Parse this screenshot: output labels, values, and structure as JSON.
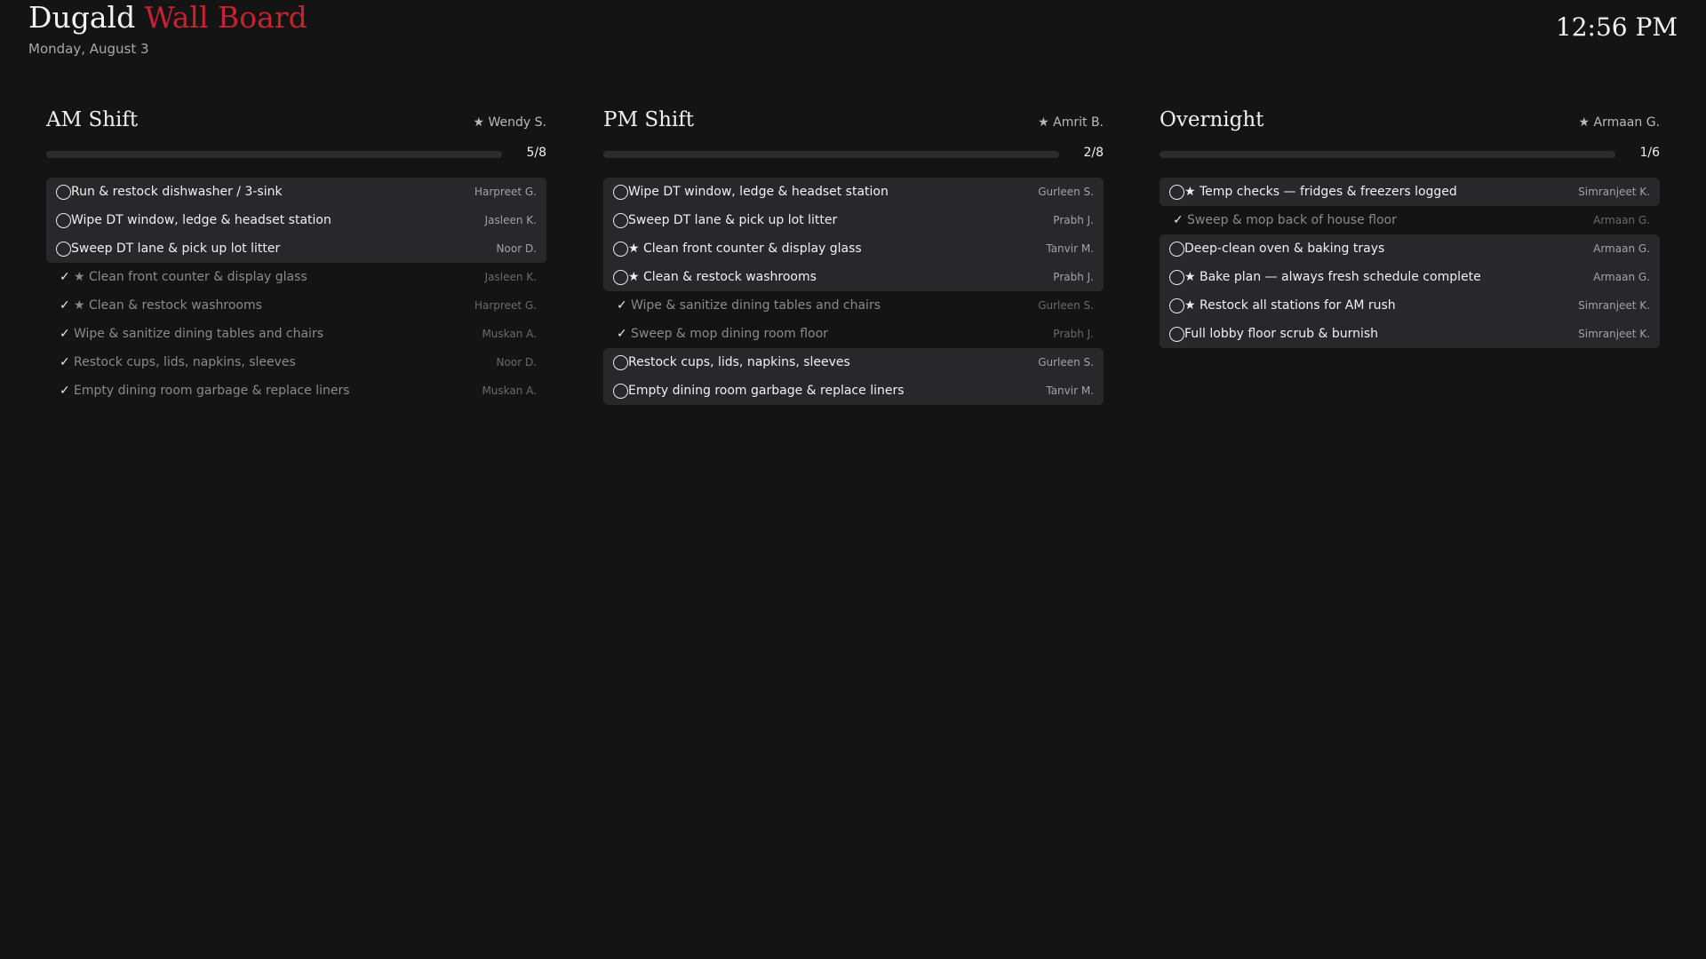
{
  "header": {
    "brand_name": "Dugald",
    "brand_suffix": "Wall Board",
    "date": "Monday, August 3",
    "time": "12:56 PM"
  },
  "colors": {
    "accent": "#c8212f",
    "background": "#141415",
    "row_open": "#28282a"
  },
  "columns": [
    {
      "title": "AM Shift",
      "lead": "★ Wendy S.",
      "progress": {
        "done": 5,
        "total": 8,
        "label": "5/8"
      },
      "tasks": [
        {
          "label": "Run & restock dishwasher / 3-sink",
          "who": "Harpreet G.",
          "done": false
        },
        {
          "label": "Wipe DT window, ledge & headset station",
          "who": "Jasleen K.",
          "done": false
        },
        {
          "label": "Sweep DT lane & pick up lot litter",
          "who": "Noor D.",
          "done": false
        },
        {
          "label": "★ Clean front counter & display glass",
          "who": "Jasleen K.",
          "done": true
        },
        {
          "label": "★ Clean & restock washrooms",
          "who": "Harpreet G.",
          "done": true
        },
        {
          "label": "Wipe & sanitize dining tables and chairs",
          "who": "Muskan A.",
          "done": true
        },
        {
          "label": "Restock cups, lids, napkins, sleeves",
          "who": "Noor D.",
          "done": true
        },
        {
          "label": "Empty dining room garbage & replace liners",
          "who": "Muskan A.",
          "done": true
        }
      ]
    },
    {
      "title": "PM Shift",
      "lead": "★ Amrit B.",
      "progress": {
        "done": 2,
        "total": 8,
        "label": "2/8"
      },
      "tasks": [
        {
          "label": "Wipe DT window, ledge & headset station",
          "who": "Gurleen S.",
          "done": false
        },
        {
          "label": "Sweep DT lane & pick up lot litter",
          "who": "Prabh J.",
          "done": false
        },
        {
          "label": "★ Clean front counter & display glass",
          "who": "Tanvir M.",
          "done": false
        },
        {
          "label": "★ Clean & restock washrooms",
          "who": "Prabh J.",
          "done": false
        },
        {
          "label": "Wipe & sanitize dining tables and chairs",
          "who": "Gurleen S.",
          "done": true
        },
        {
          "label": "Sweep & mop dining room floor",
          "who": "Prabh J.",
          "done": true
        },
        {
          "label": "Restock cups, lids, napkins, sleeves",
          "who": "Gurleen S.",
          "done": false
        },
        {
          "label": "Empty dining room garbage & replace liners",
          "who": "Tanvir M.",
          "done": false
        }
      ]
    },
    {
      "title": "Overnight",
      "lead": "★ Armaan G.",
      "progress": {
        "done": 1,
        "total": 6,
        "label": "1/6"
      },
      "tasks": [
        {
          "label": "★ Temp checks — fridges & freezers logged",
          "who": "Simranjeet K.",
          "done": false
        },
        {
          "label": "Sweep & mop back of house floor",
          "who": "Armaan G.",
          "done": true
        },
        {
          "label": "Deep-clean oven & baking trays",
          "who": "Armaan G.",
          "done": false
        },
        {
          "label": "★ Bake plan — always fresh schedule complete",
          "who": "Armaan G.",
          "done": false
        },
        {
          "label": "★ Restock all stations for AM rush",
          "who": "Simranjeet K.",
          "done": false
        },
        {
          "label": "Full lobby floor scrub & burnish",
          "who": "Simranjeet K.",
          "done": false
        }
      ]
    }
  ]
}
